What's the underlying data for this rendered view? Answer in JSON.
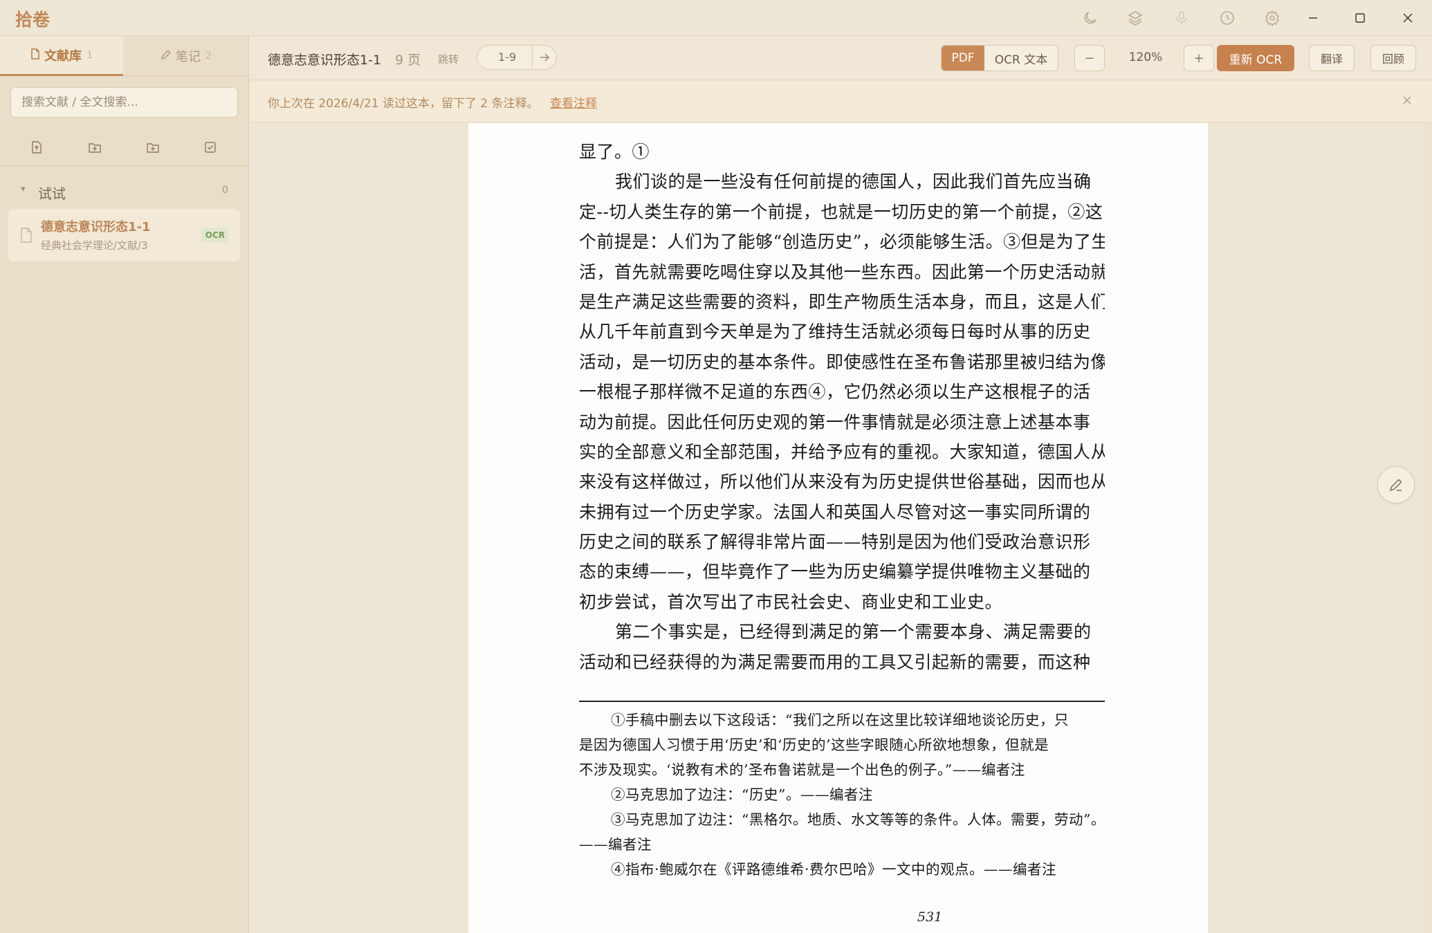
{
  "app": {
    "title": "拾卷"
  },
  "sidebar": {
    "tabs": [
      {
        "label": "文献库",
        "count": "1",
        "icon": "document-icon",
        "active": true
      },
      {
        "label": "笔记",
        "count": "2",
        "icon": "pencil-icon",
        "active": false
      }
    ],
    "search_placeholder": "搜索文献 / 全文搜索...",
    "action_icons": [
      "import-file-icon",
      "import-folder-icon",
      "new-folder-icon",
      "select-icon"
    ],
    "folder": {
      "name": "试试",
      "count": "0"
    },
    "documents": [
      {
        "title": "德意志意识形态1-1",
        "path": "经典社会学理论/文献/3",
        "badge": "OCR"
      }
    ]
  },
  "toolbar": {
    "doc_title": "德意志意识形态1-1",
    "page_count": "9 页",
    "jump_label": "跳转",
    "jump_value": "1-9",
    "view_pdf": "PDF",
    "view_ocr": "OCR 文本",
    "zoom_minus": "−",
    "zoom_level": "120%",
    "zoom_plus": "+",
    "reocr": "重新 OCR",
    "translate": "翻译",
    "review": "回顾"
  },
  "notice": {
    "text": "你上次在 2026/4/21 读过这本，留下了 2 条注释。",
    "link": "查看注释"
  },
  "page": {
    "lines": [
      {
        "t": "显了。①",
        "indent": false
      },
      {
        "t": "我们谈的是一些没有任何前提的德国人，因此我们首先应当确",
        "indent": true
      },
      {
        "t": "定--切人类生存的第一个前提，也就是一切历史的第一个前提，②这",
        "indent": false
      },
      {
        "t": "个前提是：人们为了能够“创造历史”，必须能够生活。③但是为了生",
        "indent": false
      },
      {
        "t": "活，首先就需要吃喝住穿以及其他一些东西。因此第一个历史活动就",
        "indent": false
      },
      {
        "t": "是生产满足这些需要的资料，即生产物质生活本身，而且，这是人们",
        "indent": false
      },
      {
        "t": "从几千年前直到今天单是为了维持生活就必须每日每时从事的历史",
        "indent": false
      },
      {
        "t": "活动，是一切历史的基本条件。即使感性在圣布鲁诺那里被归结为像",
        "indent": false
      },
      {
        "t": "一根棍子那样微不足道的东西④，它仍然必须以生产这根棍子的活",
        "indent": false
      },
      {
        "t": "动为前提。因此任何历史观的第一件事情就是必须注意上述基本事",
        "indent": false
      },
      {
        "t": "实的全部意义和全部范围，并给予应有的重视。大家知道，德国人从",
        "indent": false
      },
      {
        "t": "来没有这样做过，所以他们从来没有为历史提供世俗基础，因而也从",
        "indent": false
      },
      {
        "t": "未拥有过一个历史学家。法国人和英国人尽管对这一事实同所谓的",
        "indent": false
      },
      {
        "t": "历史之间的联系了解得非常片面——特别是因为他们受政治意识形",
        "indent": false
      },
      {
        "t": "态的束缚——，但毕竟作了一些为历史编纂学提供唯物主义基础的",
        "indent": false
      },
      {
        "t": "初步尝试，首次写出了市民社会史、商业史和工业史。",
        "indent": false
      },
      {
        "t": "第二个事实是，已经得到满足的第一个需要本身、满足需要的",
        "indent": true
      },
      {
        "t": "活动和已经获得的为满足需要而用的工具又引起新的需要，而这种",
        "indent": false
      }
    ],
    "footnotes": [
      {
        "t": "①手稿中删去以下这段话：“我们之所以在这里比较详细地谈论历史，只",
        "indent": true
      },
      {
        "t": "是因为德国人习惯于用‘历史’和‘历史的’这些字眼随心所欲地想象，但就是",
        "indent": false
      },
      {
        "t": "不涉及现实。‘说教有术的’圣布鲁诺就是一个出色的例子。”——编者注",
        "indent": false
      },
      {
        "t": "②马克思加了边注：“历史”。——编者注",
        "indent": true
      },
      {
        "t": "③马克思加了边注：“黑格尔。地质、水文等等的条件。人体。需要，劳动”。",
        "indent": true
      },
      {
        "t": "——编者注",
        "indent": false
      },
      {
        "t": "④指布·鲍威尔在《评路德维希·费尔巴哈》一文中的观点。——编者注",
        "indent": true
      }
    ],
    "page_number": "531"
  },
  "colors": {
    "accent": "#c6814f",
    "sidebar_bg": "#e9dfc9",
    "viewer_bg": "#eee6d5",
    "page_bg": "#fefdfb"
  }
}
